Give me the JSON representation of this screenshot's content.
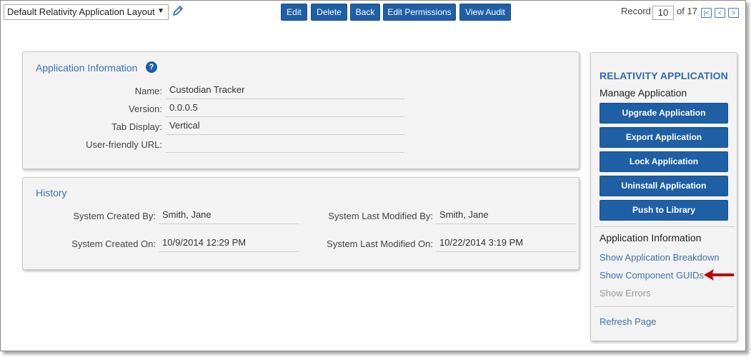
{
  "toolbar": {
    "layout_select": "Default Relativity Application Layout",
    "buttons": {
      "edit": "Edit",
      "delete": "Delete",
      "back": "Back",
      "edit_permissions": "Edit Permissions",
      "view_audit": "View Audit"
    },
    "record": {
      "label": "Record",
      "current": "10",
      "of_label": "of 17",
      "first_glyph": "|<",
      "prev_glyph": "<",
      "next_glyph": ">"
    }
  },
  "app_info": {
    "title": "Application Information",
    "help_glyph": "?",
    "fields": [
      {
        "label": "Name:",
        "value": "Custodian Tracker"
      },
      {
        "label": "Version:",
        "value": "0.0.0.5"
      },
      {
        "label": "Tab Display:",
        "value": "Vertical"
      },
      {
        "label": "User-friendly URL:",
        "value": ""
      }
    ]
  },
  "history": {
    "title": "History",
    "created_by": {
      "label": "System Created By:",
      "value": "Smith, Jane"
    },
    "created_on": {
      "label": "System Created On:",
      "value": "10/9/2014 12:29 PM"
    },
    "modified_by": {
      "label": "System Last Modified By:",
      "value": "Smith, Jane"
    },
    "modified_on": {
      "label": "System Last Modified On:",
      "value": "10/22/2014 3:19 PM"
    }
  },
  "side_panel": {
    "heading": "RELATIVITY APPLICATION",
    "manage_title": "Manage Application",
    "buttons": {
      "upgrade": "Upgrade Application",
      "export": "Export Application",
      "lock": "Lock Application",
      "uninstall": "Uninstall Application",
      "push": "Push to Library"
    },
    "info_title": "Application Information",
    "links": {
      "breakdown": "Show Application Breakdown",
      "guids": "Show Component GUIDs",
      "errors": "Show Errors",
      "refresh": "Refresh Page"
    }
  },
  "colors": {
    "accent_blue": "#1e5fa6",
    "link_blue": "#3d72b3",
    "annotation_red": "#c00000"
  },
  "icons": [
    "pencil-icon",
    "help-icon",
    "chevron-down-icon",
    "red-arrow-icon"
  ]
}
